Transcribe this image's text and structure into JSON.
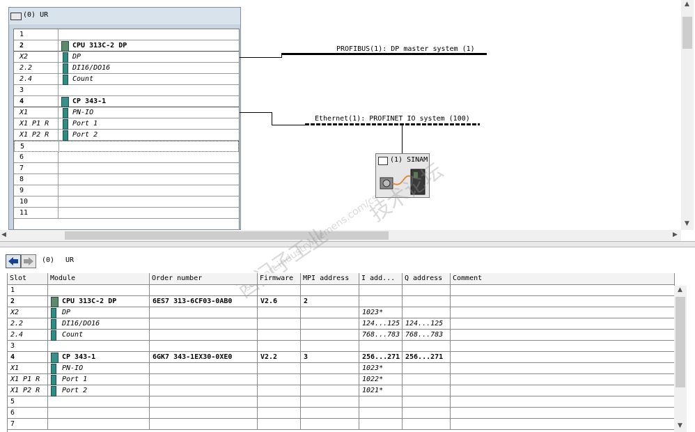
{
  "station": {
    "title": "(0) UR",
    "rack_rows": [
      {
        "slot": "1",
        "module": "",
        "slot_style": "normal",
        "icon": "none"
      },
      {
        "slot": "2",
        "module": "CPU 313C-2 DP",
        "slot_style": "bold",
        "icon": "cpu"
      },
      {
        "slot": "X2",
        "module": "DP",
        "slot_style": "ital",
        "icon": "sub"
      },
      {
        "slot": "2.2",
        "module": "DI16/DO16",
        "slot_style": "ital",
        "icon": "sub"
      },
      {
        "slot": "2.4",
        "module": "Count",
        "slot_style": "ital",
        "icon": "sub"
      },
      {
        "slot": "3",
        "module": "",
        "slot_style": "normal",
        "icon": "none"
      },
      {
        "slot": "4",
        "module": "CP 343-1",
        "slot_style": "bold",
        "icon": "cp"
      },
      {
        "slot": "X1",
        "module": "PN-IO",
        "slot_style": "ital",
        "icon": "sub"
      },
      {
        "slot": "X1 P1 R",
        "module": "Port 1",
        "slot_style": "ital",
        "icon": "sub"
      },
      {
        "slot": "X1 P2 R",
        "module": "Port 2",
        "slot_style": "ital",
        "icon": "sub"
      },
      {
        "slot": "5",
        "module": "",
        "slot_style": "normal",
        "icon": "none"
      },
      {
        "slot": "6",
        "module": "",
        "slot_style": "normal",
        "icon": "none"
      },
      {
        "slot": "7",
        "module": "",
        "slot_style": "normal",
        "icon": "none"
      },
      {
        "slot": "8",
        "module": "",
        "slot_style": "normal",
        "icon": "none"
      },
      {
        "slot": "9",
        "module": "",
        "slot_style": "normal",
        "icon": "none"
      },
      {
        "slot": "10",
        "module": "",
        "slot_style": "normal",
        "icon": "none"
      },
      {
        "slot": "11",
        "module": "",
        "slot_style": "normal",
        "icon": "none"
      }
    ]
  },
  "networks": {
    "profibus_label": "PROFIBUS(1): DP master system (1)",
    "ethernet_label": "Ethernet(1): PROFINET IO system (100)",
    "device_label": "(1) SINAM"
  },
  "detail": {
    "station_number": "(0)",
    "station_name": "UR",
    "columns": [
      "Slot",
      "Module",
      "Order number",
      "Firmware",
      "MPI address",
      "I add...",
      "Q address",
      "Comment"
    ],
    "rows": [
      {
        "slot": "1",
        "module": "",
        "order": "",
        "firmware": "",
        "mpi": "",
        "i": "",
        "q": "",
        "style": "normal",
        "icon": "none"
      },
      {
        "slot": "2",
        "module": "CPU 313C-2 DP",
        "order": "6ES7 313-6CF03-0AB0",
        "firmware": "V2.6",
        "mpi": "2",
        "i": "",
        "q": "",
        "style": "bold",
        "icon": "cpu"
      },
      {
        "slot": "X2",
        "module": "DP",
        "order": "",
        "firmware": "",
        "mpi": "",
        "i": "1023*",
        "q": "",
        "style": "ital",
        "icon": "sub"
      },
      {
        "slot": "2.2",
        "module": "DI16/DO16",
        "order": "",
        "firmware": "",
        "mpi": "",
        "i": "124...125",
        "q": "124...125",
        "style": "ital",
        "icon": "sub"
      },
      {
        "slot": "2.4",
        "module": "Count",
        "order": "",
        "firmware": "",
        "mpi": "",
        "i": "768...783",
        "q": "768...783",
        "style": "ital",
        "icon": "sub"
      },
      {
        "slot": "3",
        "module": "",
        "order": "",
        "firmware": "",
        "mpi": "",
        "i": "",
        "q": "",
        "style": "normal",
        "icon": "none"
      },
      {
        "slot": "4",
        "module": "CP 343-1",
        "order": "6GK7 343-1EX30-0XE0",
        "firmware": "V2.2",
        "mpi": "3",
        "i": "256...271",
        "q": "256...271",
        "style": "bold",
        "icon": "cp"
      },
      {
        "slot": "X1",
        "module": "PN-IO",
        "order": "",
        "firmware": "",
        "mpi": "",
        "i": "1023*",
        "q": "",
        "style": "ital",
        "icon": "sub"
      },
      {
        "slot": "X1 P1 R",
        "module": "Port 1",
        "order": "",
        "firmware": "",
        "mpi": "",
        "i": "1022*",
        "q": "",
        "style": "ital",
        "icon": "sub"
      },
      {
        "slot": "X1 P2 R",
        "module": "Port 2",
        "order": "",
        "firmware": "",
        "mpi": "",
        "i": "1021*",
        "q": "",
        "style": "ital",
        "icon": "sub"
      },
      {
        "slot": "5",
        "module": "",
        "order": "",
        "firmware": "",
        "mpi": "",
        "i": "",
        "q": "",
        "style": "normal",
        "icon": "none"
      },
      {
        "slot": "6",
        "module": "",
        "order": "",
        "firmware": "",
        "mpi": "",
        "i": "",
        "q": "",
        "style": "normal",
        "icon": "none"
      },
      {
        "slot": "7",
        "module": "",
        "order": "",
        "firmware": "",
        "mpi": "",
        "i": "",
        "q": "",
        "style": "normal",
        "icon": "none"
      }
    ]
  },
  "watermark": {
    "line1": "西门子工业",
    "line2": "support.industry.siemens.com/cs",
    "line3": "技术论坛"
  },
  "icons": {
    "station_icon": "rack-station-icon",
    "nav_back": "arrow-left-icon",
    "nav_forward": "arrow-right-icon",
    "device_icon": "drive-device-icon"
  }
}
